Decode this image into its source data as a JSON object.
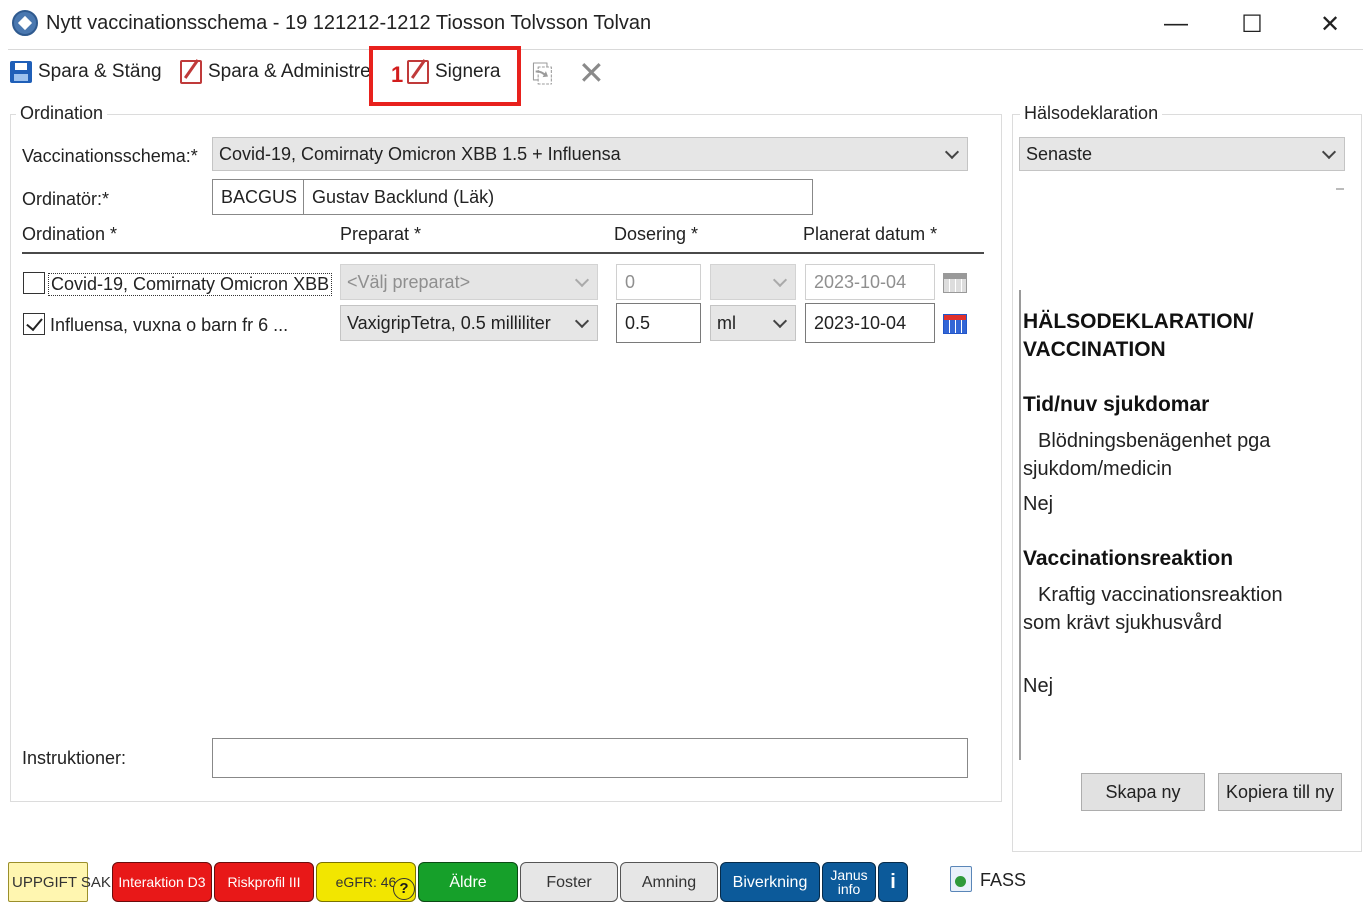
{
  "window": {
    "title": "Nytt vaccinationsschema - 19 121212-1212 Tiosson Tolvsson Tolvan",
    "minimize": "—",
    "maximize": "☐",
    "close": "✕"
  },
  "toolbar": {
    "save_close": "Spara & Stäng",
    "save_admin": "Spara & Administrera",
    "sign": "Signera",
    "callout": "1"
  },
  "ordination": {
    "group_title": "Ordination",
    "schema_label": "Vaccinationsschema:*",
    "schema_value": "Covid-19, Comirnaty Omicron XBB 1.5 + Influensa",
    "ordinator_label": "Ordinatör:*",
    "ordinator_code": "BACGUS",
    "ordinator_name": "Gustav Backlund (Läk)",
    "columns": [
      "Ordination *",
      "Preparat *",
      "Dosering *",
      "Planerat datum *"
    ],
    "rows": [
      {
        "checked": false,
        "name": "Covid-19, Comirnaty Omicron XBB",
        "preparat": "<Välj preparat>",
        "dose": "0",
        "unit": "",
        "date": "2023-10-04"
      },
      {
        "checked": true,
        "name": "Influensa, vuxna o barn fr 6 ...",
        "preparat": "VaxigripTetra, 0.5 milliliter",
        "dose": "0.5",
        "unit": "ml",
        "date": "2023-10-04"
      }
    ],
    "instructions_label": "Instruktioner:",
    "instructions_value": ""
  },
  "health": {
    "group_title": "Hälsodeklaration",
    "selected": "Senaste",
    "heading": "HÄLSODEKLARATION/ VACCINATION",
    "section1_title": "Tid/nuv sjukdomar",
    "section1_question": "Blödningsbenägenhet pga sjukdom/medicin",
    "section1_answer": "Nej",
    "section2_title": "Vaccinationsreaktion",
    "section2_question": "Kraftig vaccinationsreaktion som krävt sjukhusvård",
    "section2_answer": "Nej",
    "create_new": "Skapa ny",
    "copy_new": "Kopiera till ny"
  },
  "statusbar": {
    "missing": "UPPGIFT SAKNAS",
    "interaction": "Interaktion D3",
    "risk": "Riskprofil III",
    "egfr": "eGFR: 46",
    "egfr_help": "?",
    "elderly": "Äldre",
    "fetus": "Foster",
    "breastfeeding": "Amning",
    "side_effects": "Biverkning",
    "janus": "Janus info",
    "info": "i",
    "fass": "FASS"
  },
  "colors": {
    "callout_red": "#e8211d",
    "badge_red": "#e81818",
    "badge_yellow": "#f2e600",
    "badge_green": "#16a02a",
    "badge_gray": "#e6e6e6",
    "badge_blue": "#0c5a9a"
  }
}
